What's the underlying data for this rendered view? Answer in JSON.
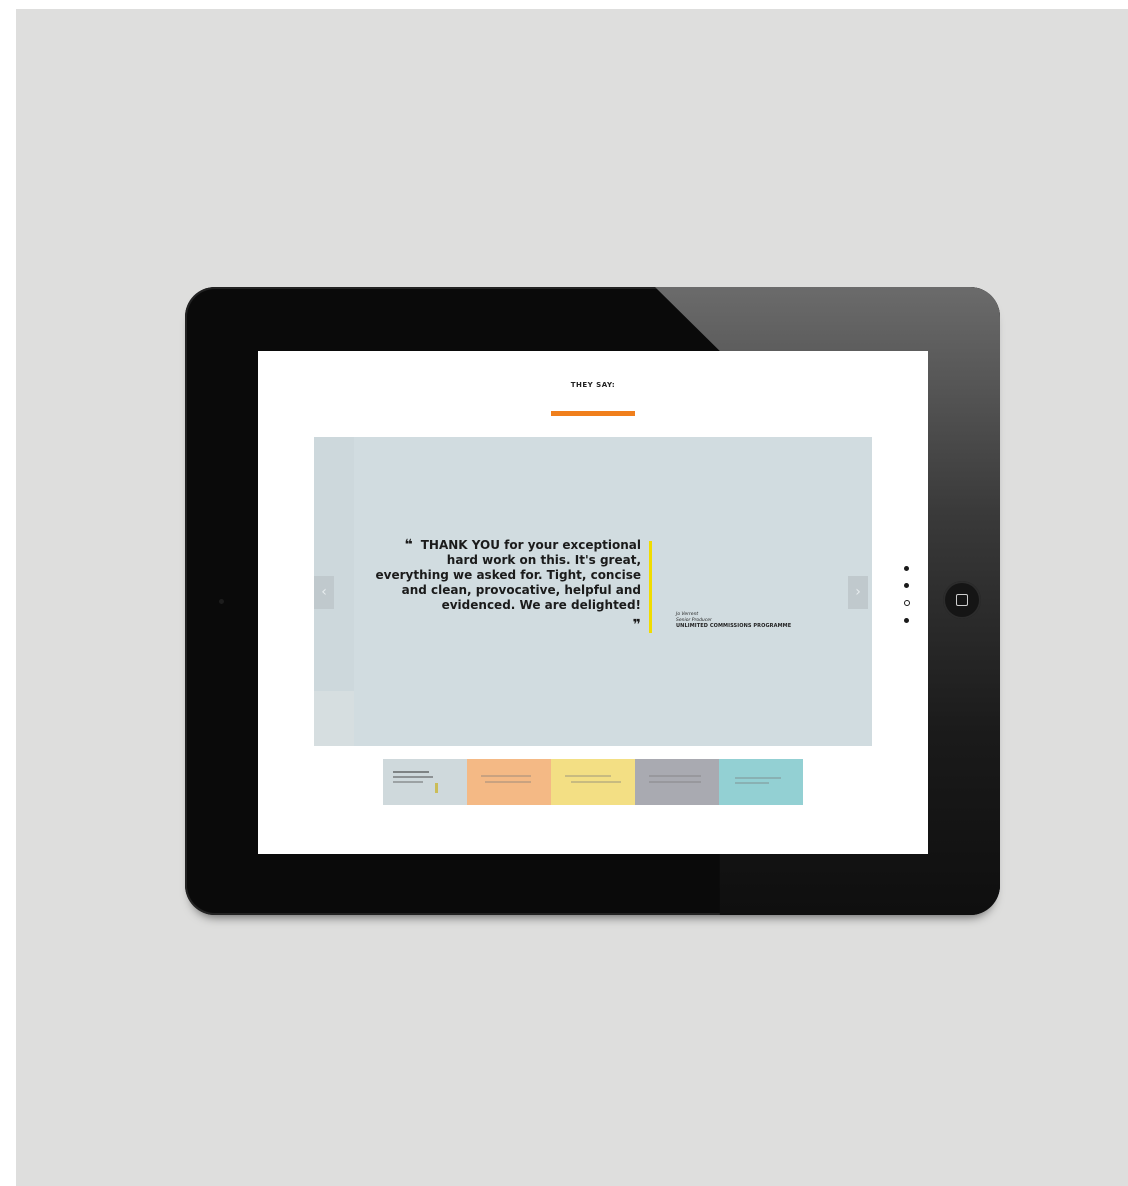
{
  "screen": {
    "heading": "THEY SAY:",
    "accent_color": "#f07f1c"
  },
  "testimonial": {
    "quote_open": "❝",
    "quote": "THANK YOU for your exceptional hard work on this. It's great, everything we asked for. Tight, concise and clean, provocative, helpful and evidenced. We are delighted!",
    "quote_close": "❞",
    "author_name": "Jo Verrent",
    "author_title": "Senior Producer",
    "author_org": "UNLIMITED COMMISSIONS PROGRAMME",
    "divider_color": "#f0dc00"
  },
  "carousel": {
    "prev_icon": "chevron-left-icon",
    "prev_glyph": "‹",
    "next_icon": "chevron-right-icon",
    "next_glyph": "›",
    "page_count": 4,
    "active_page": 3
  },
  "thumbnails": [
    {
      "color": "#cfd9dc"
    },
    {
      "color": "#f4b985"
    },
    {
      "color": "#f3df84"
    },
    {
      "color": "#a9aab1"
    },
    {
      "color": "#93d0d3"
    }
  ]
}
